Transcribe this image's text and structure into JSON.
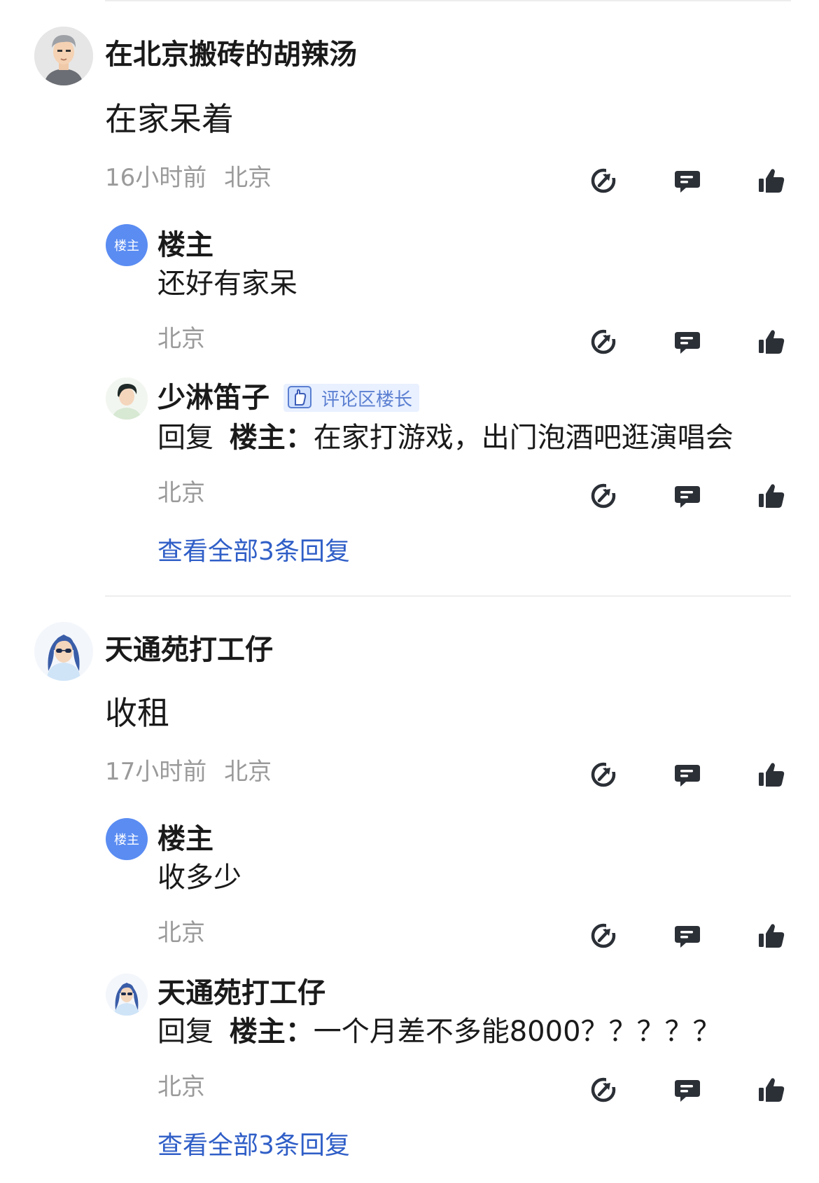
{
  "comments": [
    {
      "user": "在北京搬砖的胡辣汤",
      "content": "在家呆着",
      "time": "16小时前",
      "location": "北京",
      "replies": [
        {
          "user": "楼主",
          "avatar_text": "楼主",
          "text": "还好有家呆",
          "location": "北京"
        },
        {
          "user": "少淋笛子",
          "badge": "评论区楼长",
          "reply_prefix": "回复",
          "reply_to": "楼主：",
          "text": "在家打游戏，出门泡酒吧逛演唱会",
          "location": "北京"
        }
      ],
      "view_all": "查看全部3条回复"
    },
    {
      "user": "天通苑打工仔",
      "content": "收租",
      "time": "17小时前",
      "location": "北京",
      "replies": [
        {
          "user": "楼主",
          "avatar_text": "楼主",
          "text": "收多少",
          "location": "北京"
        },
        {
          "user": "天通苑打工仔",
          "reply_prefix": "回复",
          "reply_to": "楼主：",
          "text": "一个月差不多能8000？？？？？",
          "location": "北京"
        }
      ],
      "view_all": "查看全部3条回复"
    }
  ],
  "icons": {
    "share": "share-icon",
    "comment": "comment-icon",
    "like": "thumbs-up-icon"
  },
  "colors": {
    "link": "#2f5ec7",
    "meta": "#9a9a9a",
    "owner_avatar": "#5a8cf2",
    "badge_bg": "#e9f0ff"
  }
}
